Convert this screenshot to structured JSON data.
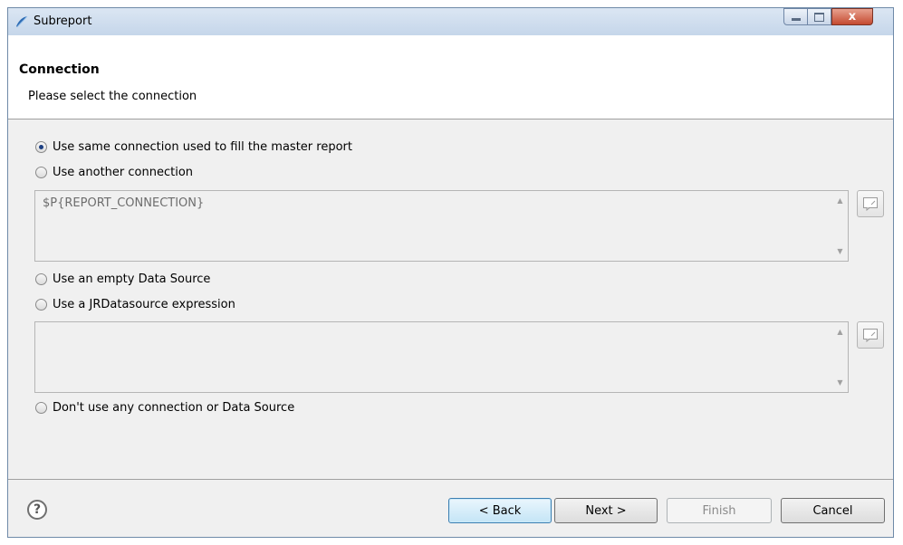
{
  "window": {
    "title": "Subreport",
    "controls": {
      "close_label": "x"
    }
  },
  "header": {
    "title": "Connection",
    "description": "Please select the connection"
  },
  "options": [
    {
      "label": "Use same connection used to fill the master report",
      "selected": true
    },
    {
      "label": "Use another connection",
      "selected": false
    },
    {
      "label": "Use an empty Data Source",
      "selected": false
    },
    {
      "label": "Use a JRDatasource expression",
      "selected": false
    },
    {
      "label": "Don't use any connection or Data Source",
      "selected": false
    }
  ],
  "connection_expression": {
    "value": "$P{REPORT_CONNECTION}"
  },
  "datasource_expression": {
    "value": ""
  },
  "footer": {
    "help_icon": "?",
    "back_label": "< Back",
    "next_label": "Next >",
    "finish_label": "Finish",
    "cancel_label": "Cancel"
  },
  "colors": {
    "selected_radio": "#1c3f82",
    "accent_button_border": "#3c7fb1"
  }
}
